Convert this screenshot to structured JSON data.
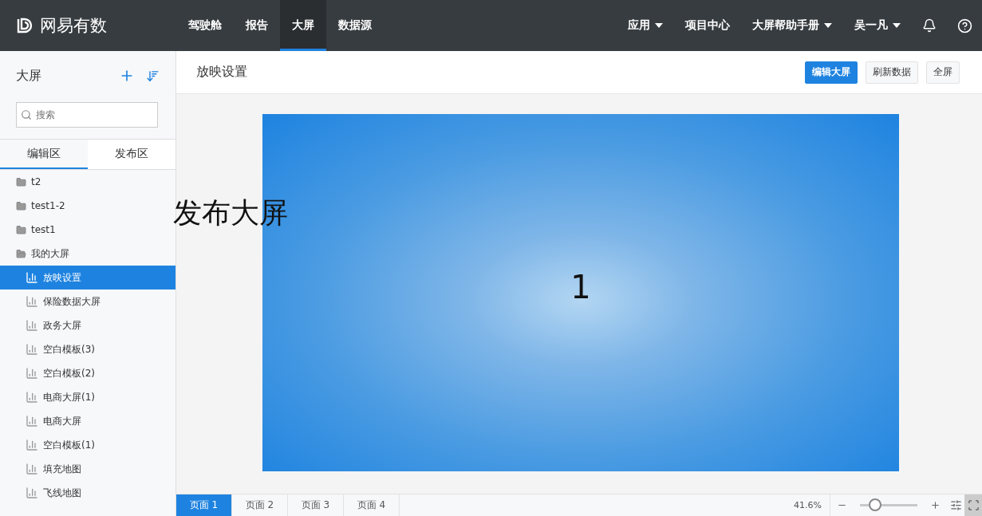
{
  "brand": {
    "name": "网易有数"
  },
  "nav": [
    {
      "label": "驾驶舱",
      "selected": false
    },
    {
      "label": "报告",
      "selected": false
    },
    {
      "label": "大屏",
      "selected": true
    },
    {
      "label": "数据源",
      "selected": false
    }
  ],
  "nav_right": [
    {
      "label": "应用",
      "kind": "dropdown"
    },
    {
      "label": "项目中心",
      "kind": "link"
    },
    {
      "label": "大屏帮助手册",
      "kind": "dropdown"
    },
    {
      "label": "吴一凡",
      "kind": "dropdown"
    }
  ],
  "sidebar": {
    "title": "大屏",
    "search": {
      "placeholder": "搜索"
    },
    "tabs": [
      {
        "label": "编辑区",
        "selected": true
      },
      {
        "label": "发布区",
        "selected": false
      }
    ],
    "items": [
      {
        "label": "t2",
        "expanded": false
      },
      {
        "label": "test1-2",
        "expanded": false
      },
      {
        "label": "test1",
        "expanded": false
      },
      {
        "label": "我的大屏",
        "expanded": true,
        "children": [
          {
            "label": "放映设置",
            "selected": true
          },
          {
            "label": "保险数据大屏",
            "selected": false
          },
          {
            "label": "政务大屏",
            "selected": false
          },
          {
            "label": "空白模板(3)",
            "selected": false
          },
          {
            "label": "空白模板(2)",
            "selected": false
          },
          {
            "label": "电商大屏(1)",
            "selected": false
          },
          {
            "label": "电商大屏",
            "selected": false
          },
          {
            "label": "空白模板(1)",
            "selected": false
          },
          {
            "label": "填充地图",
            "selected": false
          },
          {
            "label": "飞线地图",
            "selected": false
          }
        ]
      }
    ]
  },
  "overlay_text": "发布大屏",
  "toolbar": {
    "title": "放映设置",
    "buttons": [
      {
        "label": "编辑大屏",
        "kind": "primary"
      },
      {
        "label": "刷新数据",
        "kind": "default"
      },
      {
        "label": "全屏",
        "kind": "default"
      }
    ]
  },
  "canvas": {
    "text": "1"
  },
  "pages": [
    {
      "label": "页面 1",
      "selected": true
    },
    {
      "label": "页面 2",
      "selected": false
    },
    {
      "label": "页面 3",
      "selected": false
    },
    {
      "label": "页面 4",
      "selected": false
    }
  ],
  "zoom": {
    "reading": "41.6%",
    "level": 0.27
  }
}
